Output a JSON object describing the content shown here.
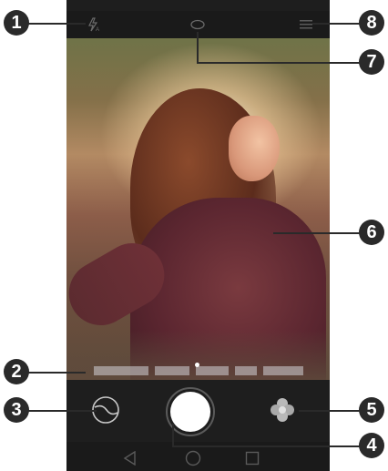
{
  "camera": {
    "topbar": {
      "flash_icon": "flash-auto-icon",
      "center_icon": "face-beauty-icon",
      "menu_icon": "menu-icon"
    },
    "viewfinder": {
      "subject": "photo-preview"
    },
    "controls": {
      "gallery_icon": "gallery-thumbnail-icon",
      "shutter_icon": "shutter-icon",
      "filter_icon": "filter-flower-icon"
    },
    "navbar": {
      "back_icon": "back-triangle-icon",
      "home_icon": "home-circle-icon",
      "recents_icon": "recents-square-icon"
    }
  },
  "callouts": [
    {
      "id": "1"
    },
    {
      "id": "2"
    },
    {
      "id": "3"
    },
    {
      "id": "4"
    },
    {
      "id": "5"
    },
    {
      "id": "6"
    },
    {
      "id": "7"
    },
    {
      "id": "8"
    }
  ],
  "colors": {
    "callout_bg": "#2a2a2a",
    "phone_bg": "#1e1e1e",
    "shutter": "#ffffff"
  }
}
